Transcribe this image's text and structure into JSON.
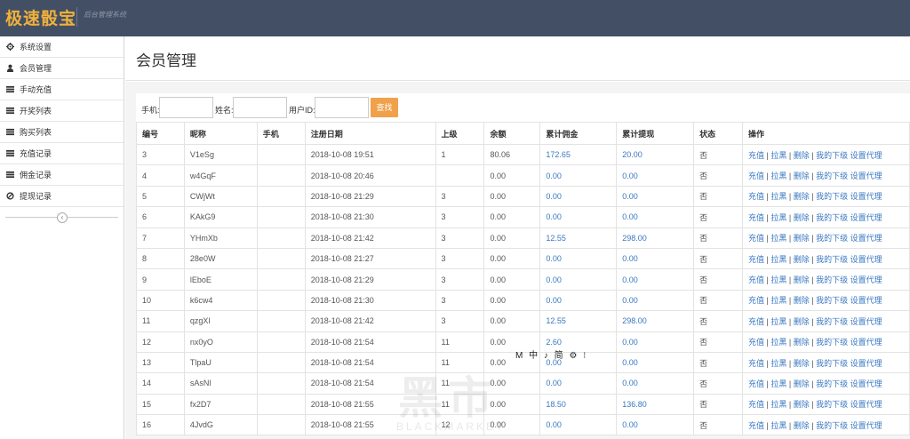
{
  "header": {
    "logo": "极速骰宝",
    "subtitle": "后台管理系统"
  },
  "sidebar": {
    "items": [
      {
        "label": "系统设置",
        "icon": "gear-icon"
      },
      {
        "label": "会员管理",
        "icon": "user-icon"
      },
      {
        "label": "手动充值",
        "icon": "list-icon"
      },
      {
        "label": "开奖列表",
        "icon": "list-icon"
      },
      {
        "label": "购买列表",
        "icon": "list-icon"
      },
      {
        "label": "充值记录",
        "icon": "list-icon"
      },
      {
        "label": "佣金记录",
        "icon": "list-icon"
      },
      {
        "label": "提现记录",
        "icon": "ban-icon"
      }
    ],
    "collapse_icon": "‹"
  },
  "page": {
    "title": "会员管理"
  },
  "search": {
    "phone_label": "手机:",
    "name_label": "姓名:",
    "uid_label": "用户ID:",
    "phone_value": "",
    "name_value": "",
    "uid_value": "",
    "button": "查找"
  },
  "table": {
    "headers": [
      "编号",
      "昵称",
      "手机",
      "注册日期",
      "上级",
      "余额",
      "累计佣金",
      "累计提现",
      "状态",
      "操作"
    ],
    "ops": {
      "recharge": "充值",
      "block": "拉黑",
      "delete": "删除",
      "children": "我的下级",
      "set_agent": "设置代理"
    },
    "rows": [
      [
        "3",
        "V1eSg",
        "",
        "2018-10-08 19:51",
        "1",
        "80.06",
        "172.65",
        "20.00",
        "否"
      ],
      [
        "4",
        "w4GqF",
        "",
        "2018-10-08 20:46",
        "",
        "0.00",
        "0.00",
        "0.00",
        "否"
      ],
      [
        "5",
        "CWjWt",
        "",
        "2018-10-08 21:29",
        "3",
        "0.00",
        "0.00",
        "0.00",
        "否"
      ],
      [
        "6",
        "KAkG9",
        "",
        "2018-10-08 21:30",
        "3",
        "0.00",
        "0.00",
        "0.00",
        "否"
      ],
      [
        "7",
        "YHmXb",
        "",
        "2018-10-08 21:42",
        "3",
        "0.00",
        "12.55",
        "298.00",
        "否"
      ],
      [
        "8",
        "28e0W",
        "",
        "2018-10-08 21:27",
        "3",
        "0.00",
        "0.00",
        "0.00",
        "否"
      ],
      [
        "9",
        "lEboE",
        "",
        "2018-10-08 21:29",
        "3",
        "0.00",
        "0.00",
        "0.00",
        "否"
      ],
      [
        "10",
        "k6cw4",
        "",
        "2018-10-08 21:30",
        "3",
        "0.00",
        "0.00",
        "0.00",
        "否"
      ],
      [
        "11",
        "qzgXl",
        "",
        "2018-10-08 21:42",
        "3",
        "0.00",
        "12.55",
        "298.00",
        "否"
      ],
      [
        "12",
        "nx0yO",
        "",
        "2018-10-08 21:54",
        "11",
        "0.00",
        "2.60",
        "0.00",
        "否"
      ],
      [
        "13",
        "TlpaU",
        "",
        "2018-10-08 21:54",
        "11",
        "0.00",
        "0.00",
        "0.00",
        "否"
      ],
      [
        "14",
        "sAsNl",
        "",
        "2018-10-08 21:54",
        "11",
        "0.00",
        "0.00",
        "0.00",
        "否"
      ],
      [
        "15",
        "fx2D7",
        "",
        "2018-10-08 21:55",
        "11",
        "0.00",
        "18.50",
        "136.80",
        "否"
      ],
      [
        "16",
        "4JvdG",
        "",
        "2018-10-08 21:55",
        "12",
        "0.00",
        "0.00",
        "0.00",
        "否"
      ]
    ]
  },
  "ime_bar": "M 中 ♪ 简 ⚙ ⁝",
  "watermark": {
    "main": "黑市",
    "sub": "BLACKMARKET"
  },
  "colors": {
    "topbar": "#434f64",
    "logo": "#f0b13c",
    "link": "#3a78c2",
    "search_button": "#f0a14a"
  }
}
